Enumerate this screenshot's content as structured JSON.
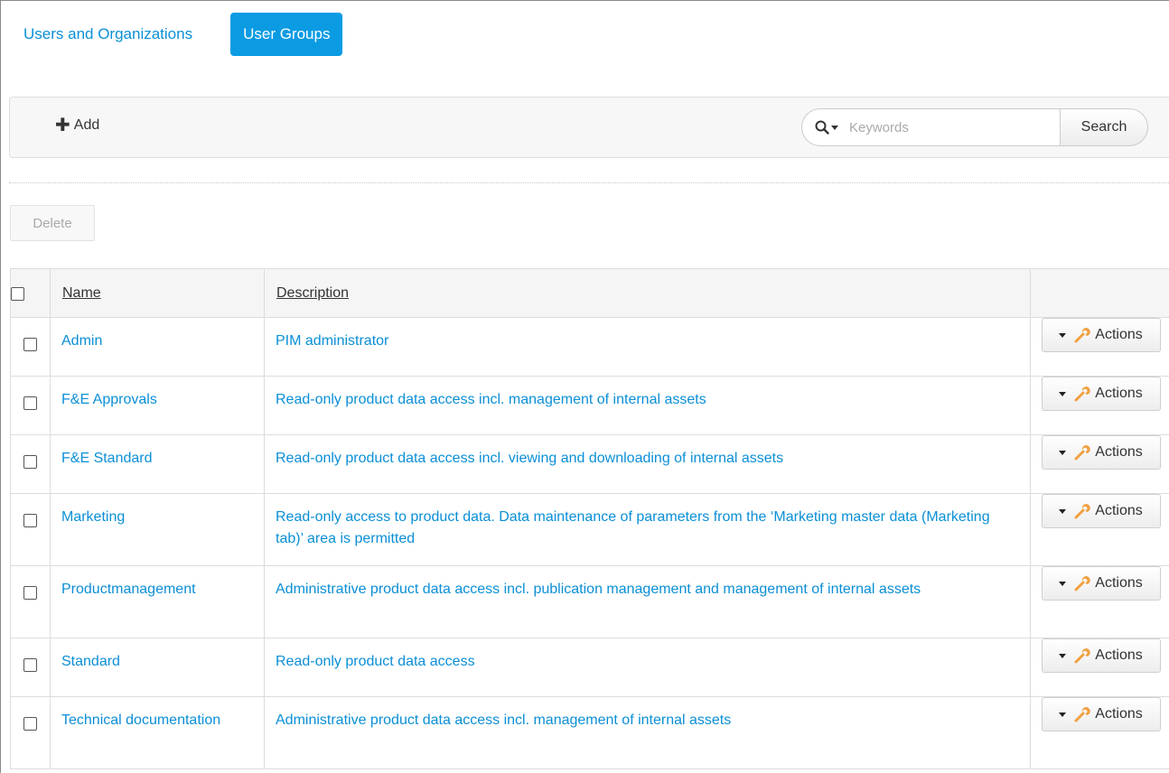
{
  "tabs": [
    {
      "label": "Users and Organizations",
      "active": false
    },
    {
      "label": "User Groups",
      "active": true
    }
  ],
  "toolbar": {
    "add_label": "Add",
    "search_placeholder": "Keywords",
    "search_button": "Search"
  },
  "delete_label": "Delete",
  "table": {
    "headers": {
      "name": "Name",
      "description": "Description"
    },
    "action_label": "Actions",
    "rows": [
      {
        "name": "Admin",
        "description": "PIM administrator"
      },
      {
        "name": "F&E Approvals",
        "description": "Read-only product data access incl. management of internal assets"
      },
      {
        "name": "F&E Standard",
        "description": "Read-only product data access incl. viewing and downloading of internal assets"
      },
      {
        "name": "Marketing",
        "description": "Read-only access to product data. Data maintenance of parameters from the ‘Marketing master data (Marketing tab)’ area is permitted"
      },
      {
        "name": "Productmanagement",
        "description": "Administrative product data access incl. publication management and management of internal assets"
      },
      {
        "name": "Standard",
        "description": "Read-only product data access"
      },
      {
        "name": "Technical documentation",
        "description": "Administrative product data access incl. management of internal assets"
      }
    ]
  },
  "colors": {
    "accent": "#0a9be3",
    "link": "#0b8fd6",
    "wrench": "#f0a040"
  },
  "icons": {
    "add": "plus-icon",
    "search": "magnifier-icon",
    "actions": "wrench-icon"
  }
}
